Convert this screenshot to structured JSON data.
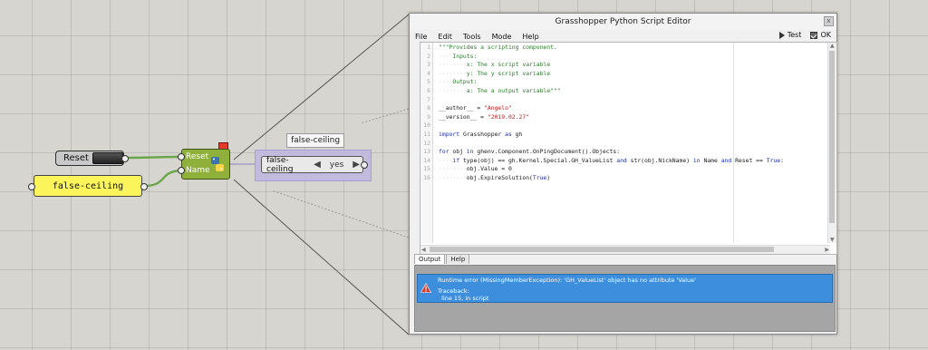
{
  "canvas": {
    "reset_button": {
      "label": "Reset"
    },
    "panel": {
      "text": "false-ceiling"
    },
    "python_component": {
      "inputs": [
        "Reset",
        "Name"
      ]
    },
    "value_list": {
      "tooltip": "false-ceiling",
      "name": "false-ceiling",
      "value": "yes"
    }
  },
  "editor": {
    "title": "Grasshopper Python Script Editor",
    "close_label": "x",
    "menu": [
      "File",
      "Edit",
      "Tools",
      "Mode",
      "Help"
    ],
    "toolbar": {
      "test_label": "Test",
      "ok_label": "OK"
    },
    "line_numbers": [
      "1",
      "2",
      "3",
      "4",
      "5",
      "6",
      "7",
      "8",
      "9",
      "10",
      "11",
      "12",
      "13",
      "14",
      "15",
      "16"
    ],
    "output_tabs": [
      "Output",
      "Help"
    ],
    "error": {
      "message": "Runtime error (MissingMemberException): 'GH_ValueList' object has no attribute 'Value'",
      "traceback_label": "Traceback:",
      "traceback_line": "  line 15, in script"
    }
  },
  "colors": {
    "canvas_bg": "#d6d5cf",
    "panel_yellow": "#fbf45b",
    "component_green": "#8fb03a",
    "wire_green": "#6aa64a",
    "value_list_purple": "#beb6e1",
    "error_blue": "#3d8fde"
  },
  "icons": {
    "python_component": "python-logo-icon",
    "warning_flag": "flag-icon",
    "test": "play-icon",
    "ok": "checkbox-icon",
    "error": "warning-icon"
  }
}
